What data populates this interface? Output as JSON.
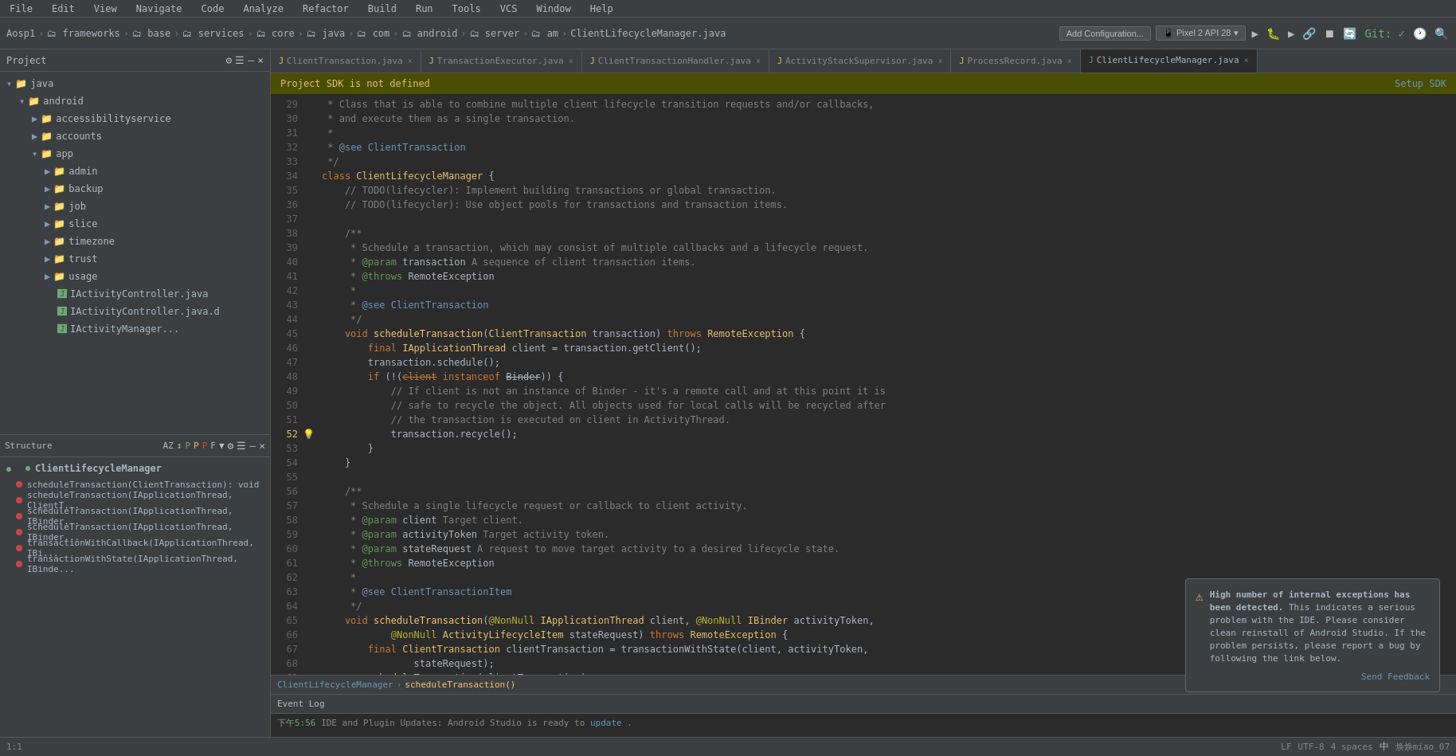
{
  "menuBar": {
    "items": [
      "File",
      "Edit",
      "View",
      "Navigate",
      "Code",
      "Analyze",
      "Refactor",
      "Build",
      "Run",
      "Tools",
      "VCS",
      "Window",
      "Help"
    ]
  },
  "toolbar": {
    "breadcrumb": [
      "Aosp1",
      "frameworks",
      "base",
      "services",
      "core",
      "java",
      "com",
      "android",
      "server",
      "am",
      "ClientLifecycleManager.java"
    ],
    "addConfiguration": "Add Configuration...",
    "device": "Pixel 2 API 28",
    "git": "Git:",
    "gitStatus": "✓"
  },
  "tabs": [
    {
      "label": "ClientTransaction.java",
      "active": false
    },
    {
      "label": "TransactionExecutor.java",
      "active": false
    },
    {
      "label": "ClientTransactionHandler.java",
      "active": false
    },
    {
      "label": "ActivityStackSupervisor.java",
      "active": false
    },
    {
      "label": "ProcessRecord.java",
      "active": false
    },
    {
      "label": "ClientLifecycleManager.java",
      "active": true
    }
  ],
  "warningBar": {
    "message": "Project SDK is not defined",
    "action": "Setup SDK"
  },
  "projectPanel": {
    "title": "Project",
    "tree": [
      {
        "level": 1,
        "icon": "folder",
        "label": "java",
        "expanded": true
      },
      {
        "level": 2,
        "icon": "folder",
        "label": "android",
        "expanded": true
      },
      {
        "level": 3,
        "icon": "folder",
        "label": "accessibilityservice"
      },
      {
        "level": 3,
        "icon": "folder",
        "label": "accounts"
      },
      {
        "level": 3,
        "icon": "folder",
        "label": "app",
        "expanded": true
      },
      {
        "level": 4,
        "icon": "folder",
        "label": "admin"
      },
      {
        "level": 4,
        "icon": "folder",
        "label": "backup"
      },
      {
        "level": 4,
        "icon": "folder",
        "label": "job"
      },
      {
        "level": 4,
        "icon": "folder",
        "label": "slice"
      },
      {
        "level": 4,
        "icon": "folder",
        "label": "timezone"
      },
      {
        "level": 4,
        "icon": "folder",
        "label": "trust"
      },
      {
        "level": 4,
        "icon": "folder",
        "label": "usage"
      },
      {
        "level": 4,
        "icon": "java",
        "label": "IActivityController.java"
      },
      {
        "level": 4,
        "icon": "java",
        "label": "IActivityController.java.d"
      },
      {
        "level": 4,
        "icon": "java",
        "label": "IActivityManager..."
      }
    ]
  },
  "structurePanel": {
    "title": "Structure",
    "className": "ClientLifecycleManager",
    "methods": [
      {
        "name": "scheduleTransaction(ClientTransaction): void",
        "status": "red"
      },
      {
        "name": "scheduleTransaction(IApplicationThread, ClientT...",
        "status": "red"
      },
      {
        "name": "scheduleTransaction(IApplicationThread, IBinder...",
        "status": "red"
      },
      {
        "name": "scheduleTransaction(IApplicationThread, IBinder...",
        "status": "red"
      },
      {
        "name": "transactionWithCallback(IApplicationThread, IBi...",
        "status": "red"
      },
      {
        "name": "transactionWithState(IApplicationThread, IBinde...",
        "status": "red"
      }
    ]
  },
  "codeLines": [
    {
      "num": 29,
      "code": "cm_29"
    },
    {
      "num": 30,
      "code": "cm_30"
    },
    {
      "num": 31,
      "code": "cm_31"
    },
    {
      "num": 32,
      "code": "cm_32"
    },
    {
      "num": 33,
      "code": "cm_33"
    },
    {
      "num": 34,
      "code": "cm_34"
    },
    {
      "num": 35,
      "code": "cm_35"
    },
    {
      "num": 36,
      "code": "cm_36"
    },
    {
      "num": 37,
      "code": "cm_37"
    },
    {
      "num": 38,
      "code": "cm_38"
    }
  ],
  "breadcrumbBottom": {
    "class": "ClientLifecycleManager",
    "method": "scheduleTransaction()"
  },
  "notification": {
    "title": "High number of internal exceptions has been detected.",
    "body": "This indicates a serious problem with the IDE. Please consider clean reinstall of Android Studio. If the problem persists, please report a bug by following the link below.",
    "actionLabel": "Send Feedback"
  },
  "eventLog": {
    "title": "Event Log",
    "entry": {
      "time": "下午5:56",
      "message": "IDE and Plugin Updates: Android Studio is ready to",
      "link": "update"
    }
  },
  "statusBar": {
    "right": {
      "ime": "中",
      "user": "焕焕miao_07"
    }
  }
}
